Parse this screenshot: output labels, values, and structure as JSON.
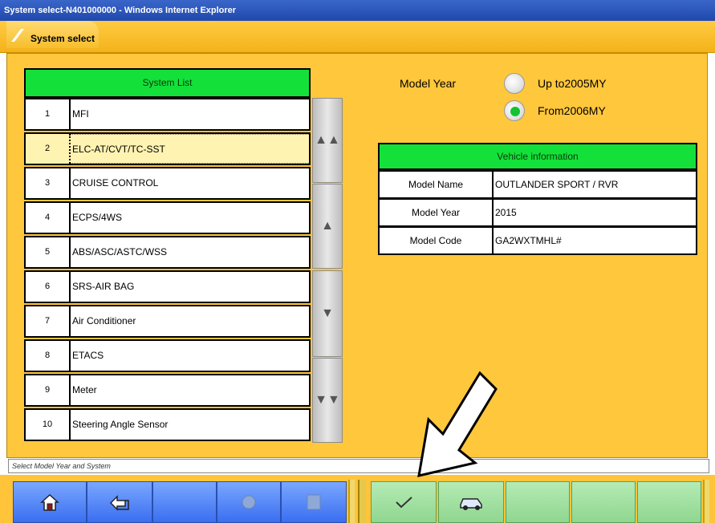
{
  "window": {
    "title": "System select-N401000000 - Windows Internet Explorer"
  },
  "header": {
    "title": "System select"
  },
  "system_list": {
    "title": "System List",
    "items": [
      {
        "num": "1",
        "label": "MFI"
      },
      {
        "num": "2",
        "label": "ELC-AT/CVT/TC-SST",
        "selected": true
      },
      {
        "num": "3",
        "label": "CRUISE CONTROL"
      },
      {
        "num": "4",
        "label": "ECPS/4WS"
      },
      {
        "num": "5",
        "label": "ABS/ASC/ASTC/WSS"
      },
      {
        "num": "6",
        "label": "SRS-AIR BAG"
      },
      {
        "num": "7",
        "label": "Air Conditioner"
      },
      {
        "num": "8",
        "label": "ETACS"
      },
      {
        "num": "9",
        "label": "Meter"
      },
      {
        "num": "10",
        "label": "Steering Angle Sensor"
      }
    ]
  },
  "scroll": {
    "top": "▲▲",
    "up": "▲",
    "down": "▼",
    "bottom": "▼▼"
  },
  "model_year": {
    "label": "Model Year",
    "options": [
      {
        "label": "Up to2005MY",
        "selected": false
      },
      {
        "label": "From2006MY",
        "selected": true
      }
    ]
  },
  "vehicle_info": {
    "title": "Vehicle information",
    "rows": [
      {
        "key": "Model Name",
        "value": "OUTLANDER SPORT / RVR"
      },
      {
        "key": "Model Year",
        "value": "2015"
      },
      {
        "key": "Model Code",
        "value": "GA2WXTMHL#"
      }
    ]
  },
  "status": {
    "text": "Select Model Year and System"
  },
  "toolbar": {
    "home_icon": "home-icon",
    "back_icon": "back-icon",
    "ok_icon": "checkmark-icon",
    "vehicle_icon": "vehicle-icon"
  },
  "colors": {
    "accent_yellow": "#ffc73c",
    "list_header_green": "#13e13a",
    "button_blue": "#3a6ef0",
    "button_green": "#8fd68f"
  }
}
